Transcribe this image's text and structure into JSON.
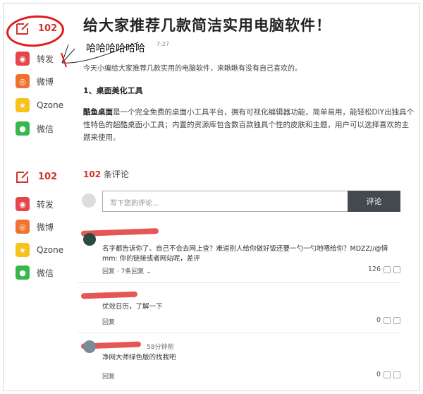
{
  "article": {
    "title": "给大家推荐几款简洁实用电脑软件！",
    "handwritten_note": "哈哈哈哈哈哈",
    "timestamp": "7:27",
    "intro": "今天小编给大家推荐几款实用的电脑软件，来瞅瞅有没有自己喜欢的。",
    "section_heading": "1、桌面美化工具",
    "app_name": "酷鱼桌面",
    "section_body": "是一个完全免费的桌面小工具平台，拥有可视化编辑器功能，简单易用，能轻松DIY出独具个性特色的超酷桌面小工具；内置的资源库包含数百款独具个性的皮肤和主题，用户可以选择喜欢的主题来使用。"
  },
  "share_bar": {
    "comment_count": "102",
    "items": [
      {
        "label": "转发",
        "icon": "repost-icon"
      },
      {
        "label": "微博",
        "icon": "weibo-icon"
      },
      {
        "label": "Qzone",
        "icon": "qzone-icon"
      },
      {
        "label": "微信",
        "icon": "wechat-icon"
      }
    ]
  },
  "comments_section": {
    "count": "102",
    "count_suffix": "条评论",
    "input_placeholder": "写下您的评论...",
    "submit_label": "评论",
    "comments": [
      {
        "text": "名字都告诉你了、自己不会去网上查？难道别人给你做好饭还要一勺一勺地喂给你？MDZZ//@情mm: 你的链接或者网站呢，差评",
        "reply_label": "回复",
        "replies_label": "7条回复",
        "likes": "126"
      },
      {
        "text": "优效日历，了解一下",
        "reply_label": "回复",
        "likes": "0"
      },
      {
        "time": "58分钟前",
        "text": "净网大师绿色版的找我吧",
        "reply_label": "回复",
        "likes": "0"
      }
    ]
  },
  "colors": {
    "accent_red": "#d2322d",
    "annotation_red": "#e21a1a",
    "button_dark": "#444950"
  }
}
